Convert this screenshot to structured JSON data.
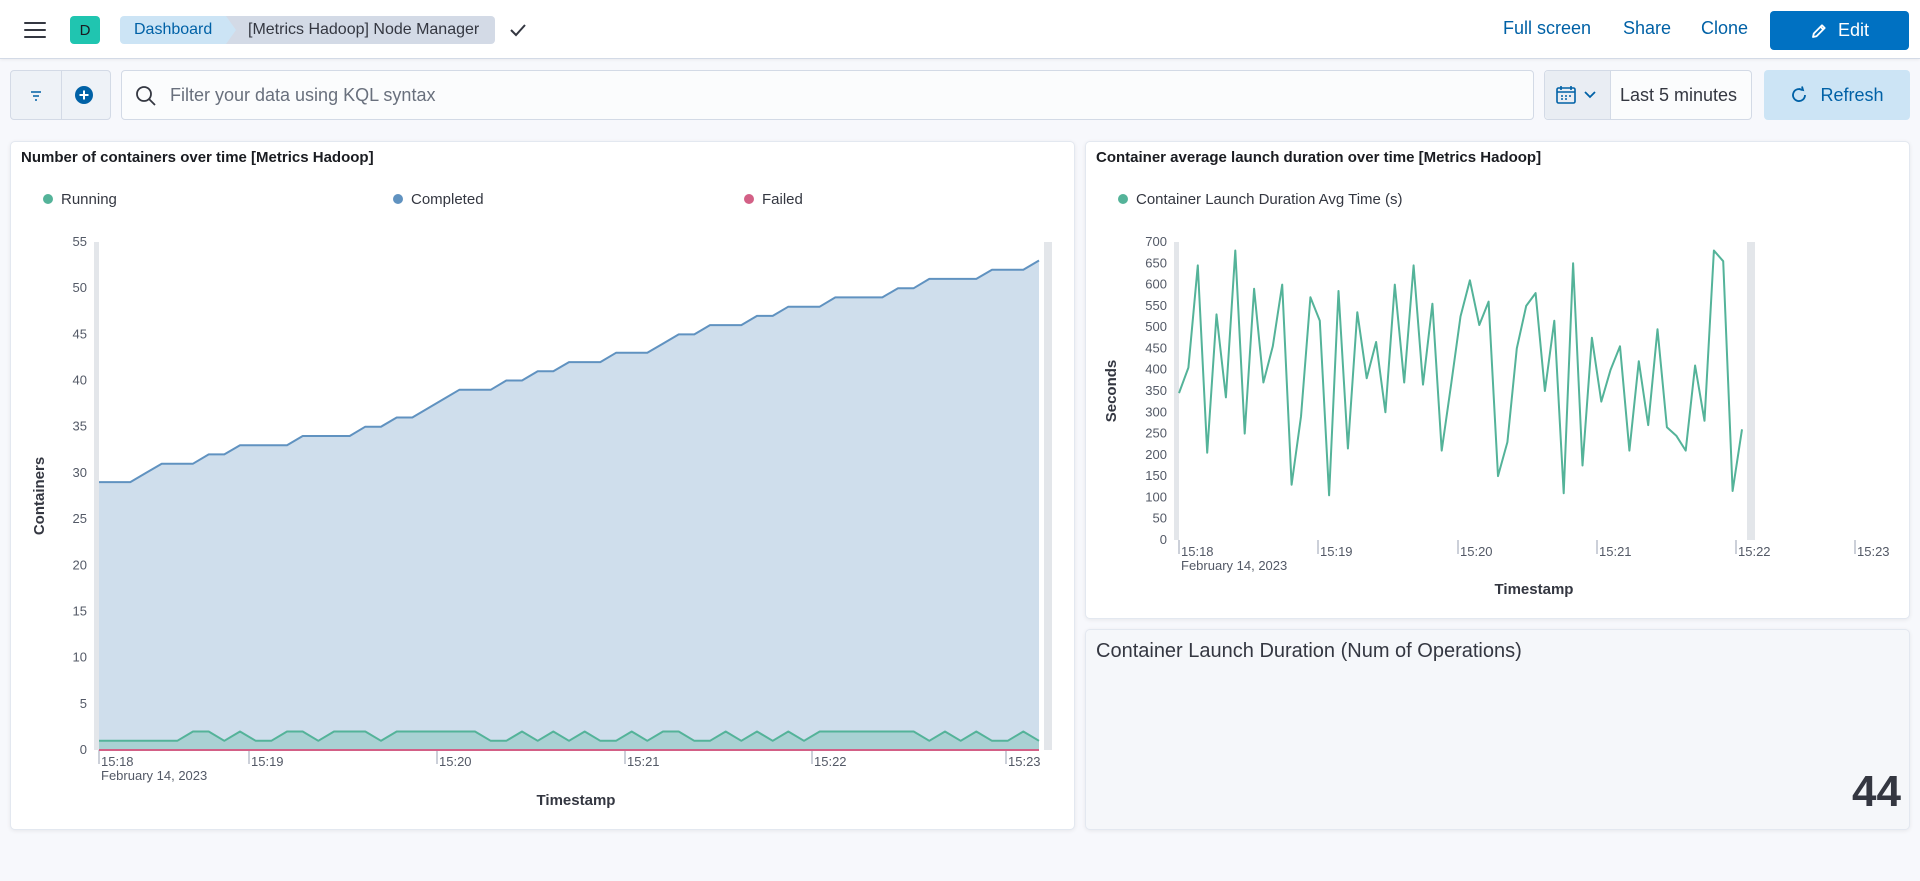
{
  "header": {
    "avatar_letter": "D",
    "breadcrumbs": [
      "Dashboard",
      "[Metrics Hadoop] Node Manager"
    ],
    "full_screen": "Full screen",
    "share": "Share",
    "clone": "Clone",
    "edit": "Edit"
  },
  "query_bar": {
    "search_placeholder": "Filter your data using KQL syntax",
    "search_value": "",
    "date_range": "Last 5 minutes",
    "refresh": "Refresh"
  },
  "colors": {
    "primary": "#0071c2",
    "running": "#54b399",
    "completed": "#6092c0",
    "failed": "#d36086"
  },
  "panels": {
    "containers": {
      "title": "Number of containers over time [Metrics Hadoop]"
    },
    "launch_duration": {
      "title": "Container average launch duration over time [Metrics Hadoop]"
    },
    "metric": {
      "title": "Container Launch Duration (Num of Operations)",
      "value": "44"
    }
  },
  "chart_data": [
    {
      "type": "area",
      "ylabel": "Containers",
      "xlabel": "Timestamp",
      "ylim": [
        0,
        55
      ],
      "yticks": [
        0,
        5,
        10,
        15,
        20,
        25,
        30,
        35,
        40,
        45,
        50,
        55
      ],
      "xticks": [
        "15:18",
        "15:19",
        "15:20",
        "15:21",
        "15:22",
        "15:23"
      ],
      "xdate": "February 14, 2023",
      "legend": [
        "Running",
        "Completed",
        "Failed"
      ],
      "legend_position": "top",
      "series": [
        {
          "name": "Completed",
          "values": [
            29,
            29,
            29,
            30,
            31,
            31,
            31,
            32,
            32,
            33,
            33,
            33,
            33,
            34,
            34,
            34,
            34,
            35,
            35,
            36,
            36,
            37,
            38,
            39,
            39,
            39,
            40,
            40,
            41,
            41,
            42,
            42,
            42,
            43,
            43,
            43,
            44,
            45,
            45,
            46,
            46,
            46,
            47,
            47,
            48,
            48,
            48,
            49,
            49,
            49,
            49,
            50,
            50,
            51,
            51,
            51,
            51,
            52,
            52,
            52,
            53
          ]
        },
        {
          "name": "Running",
          "values": [
            1,
            1,
            1,
            1,
            1,
            1,
            2,
            2,
            1,
            2,
            1,
            1,
            2,
            2,
            1,
            2,
            2,
            2,
            1,
            2,
            2,
            2,
            2,
            2,
            2,
            1,
            1,
            2,
            1,
            2,
            1,
            2,
            1,
            1,
            2,
            1,
            2,
            2,
            1,
            1,
            2,
            1,
            2,
            1,
            2,
            1,
            2,
            2,
            2,
            2,
            2,
            2,
            2,
            1,
            2,
            1,
            2,
            1,
            1,
            2,
            1
          ]
        },
        {
          "name": "Failed",
          "values": [
            0,
            0,
            0,
            0,
            0,
            0,
            0,
            0,
            0,
            0,
            0,
            0,
            0,
            0,
            0,
            0,
            0,
            0,
            0,
            0,
            0,
            0,
            0,
            0,
            0,
            0,
            0,
            0,
            0,
            0,
            0,
            0,
            0,
            0,
            0,
            0,
            0,
            0,
            0,
            0,
            0,
            0,
            0,
            0,
            0,
            0,
            0,
            0,
            0,
            0,
            0,
            0,
            0,
            0,
            0,
            0,
            0,
            0,
            0,
            0,
            0
          ]
        }
      ]
    },
    {
      "type": "line",
      "ylabel": "Seconds",
      "xlabel": "Timestamp",
      "ylim": [
        0,
        700
      ],
      "yticks": [
        0,
        50,
        100,
        150,
        200,
        250,
        300,
        350,
        400,
        450,
        500,
        550,
        600,
        650,
        700
      ],
      "xticks": [
        "15:18",
        "15:19",
        "15:20",
        "15:21",
        "15:22",
        "15:23"
      ],
      "xdate": "February 14, 2023",
      "legend": [
        "Container Launch Duration Avg Time (s)"
      ],
      "legend_position": "top",
      "series": [
        {
          "name": "Container Launch Duration Avg Time (s)",
          "values": [
            345,
            405,
            645,
            205,
            530,
            335,
            680,
            250,
            590,
            370,
            455,
            600,
            130,
            290,
            570,
            515,
            105,
            585,
            215,
            535,
            380,
            465,
            300,
            600,
            370,
            645,
            365,
            555,
            210,
            365,
            525,
            610,
            505,
            560,
            150,
            230,
            450,
            550,
            580,
            350,
            515,
            110,
            650,
            175,
            475,
            325,
            400,
            455,
            210,
            420,
            270,
            495,
            265,
            245,
            210,
            410,
            280,
            680,
            655,
            115,
            260
          ]
        }
      ]
    }
  ]
}
